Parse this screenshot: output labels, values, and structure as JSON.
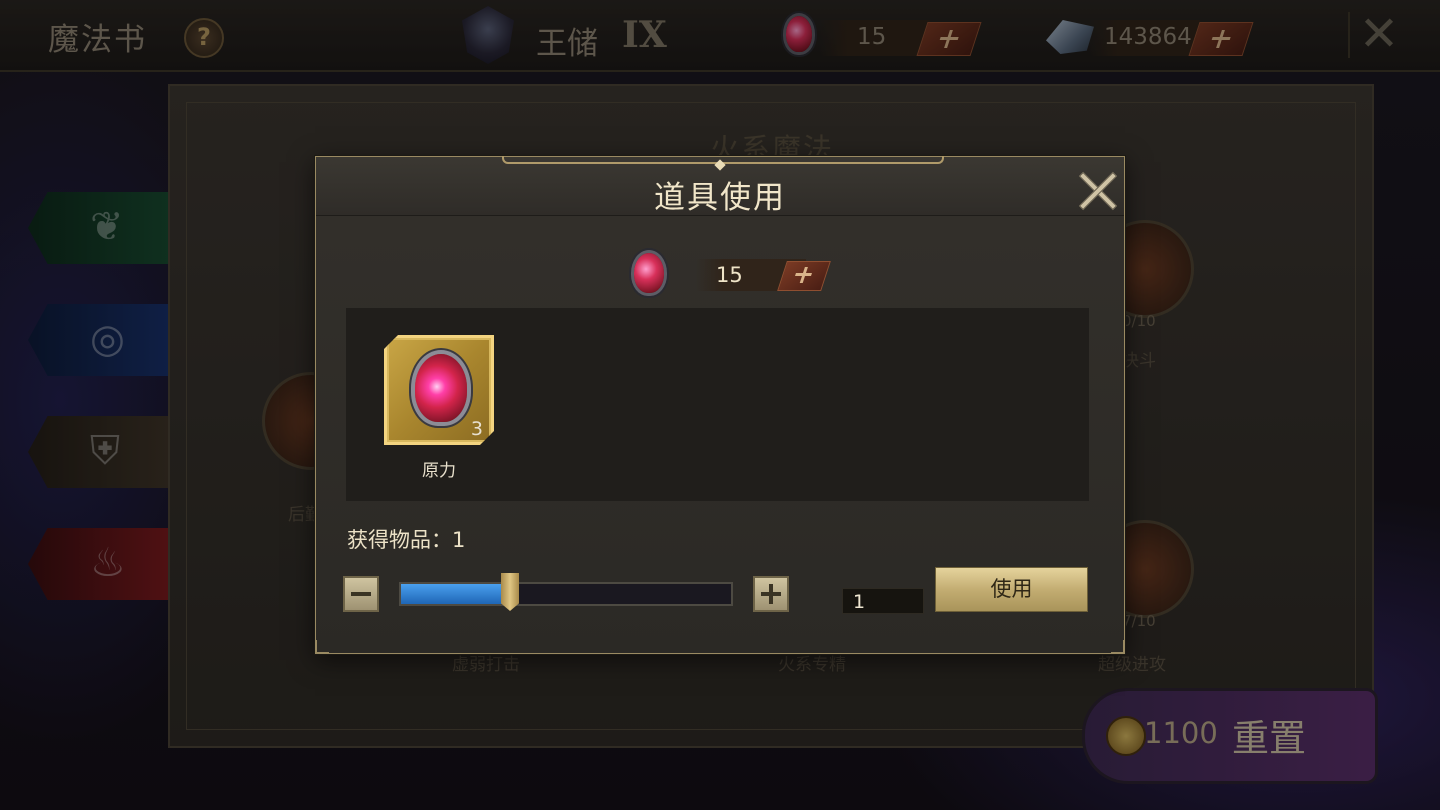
{
  "topbar": {
    "title": "魔法书",
    "help_label": "?",
    "rank_name": "王储",
    "rank_level": "IX",
    "gem_count": "15",
    "crystal_count": "143864",
    "close_label": "✕"
  },
  "book": {
    "heading": "火系魔法",
    "nodes": [
      {
        "count": "0/10",
        "label": "决斗"
      },
      {
        "count": "7/10",
        "label": "超级进攻"
      },
      {
        "label": "后勤"
      },
      {
        "label": "虚弱打击"
      },
      {
        "label": "火系专精"
      }
    ],
    "reset_cost": "1100",
    "reset_label": "重置"
  },
  "modal": {
    "title": "道具使用",
    "current_count": "15",
    "item": {
      "name": "原力",
      "count": "3"
    },
    "gain_label": "获得物品：1",
    "quantity": "1",
    "use_label": "使用",
    "slider_fraction": 0.33
  },
  "colors": {
    "gold": "#f3d480",
    "slider_blue": "#2f80d6",
    "gem_red": "#d2244a"
  }
}
